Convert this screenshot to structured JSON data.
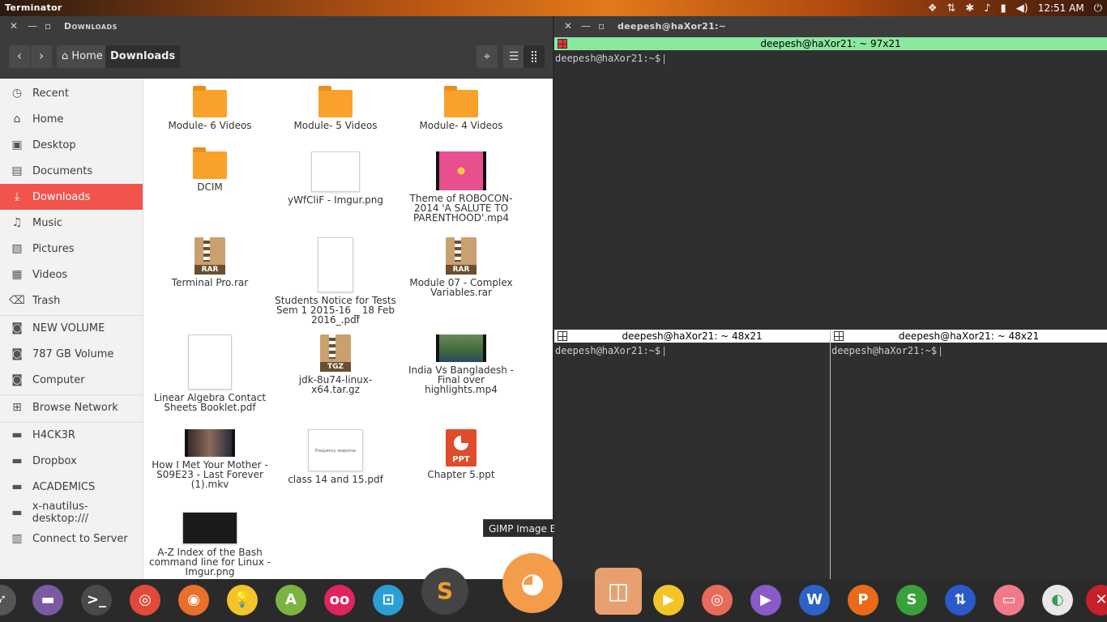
{
  "top_panel": {
    "app_title": "Terminator",
    "clock": "12:51 AM",
    "indicators": [
      "dropbox-icon",
      "network-arrows-icon",
      "bluetooth-icon",
      "notifications-bell-icon",
      "battery-icon",
      "volume-icon",
      "power-icon"
    ]
  },
  "files": {
    "window_title": "Downloads",
    "crumb_home": "Home",
    "crumb_current": "Downloads",
    "sidebar": [
      {
        "label": "Recent",
        "icon": "clock-icon"
      },
      {
        "label": "Home",
        "icon": "home-icon"
      },
      {
        "label": "Desktop",
        "icon": "desktop-icon"
      },
      {
        "label": "Documents",
        "icon": "document-icon"
      },
      {
        "label": "Downloads",
        "icon": "download-icon"
      },
      {
        "label": "Music",
        "icon": "music-icon"
      },
      {
        "label": "Pictures",
        "icon": "picture-icon"
      },
      {
        "label": "Videos",
        "icon": "video-icon"
      },
      {
        "label": "Trash",
        "icon": "trash-icon"
      },
      {
        "label": "NEW VOLUME",
        "icon": "drive-icon"
      },
      {
        "label": "787 GB Volume",
        "icon": "drive-icon"
      },
      {
        "label": "Computer",
        "icon": "computer-icon"
      },
      {
        "label": "Browse Network",
        "icon": "network-icon"
      },
      {
        "label": "H4CK3R",
        "icon": "folder-icon"
      },
      {
        "label": "Dropbox",
        "icon": "folder-icon"
      },
      {
        "label": "ACADEMICS",
        "icon": "folder-icon"
      },
      {
        "label": "x-nautilus-desktop:///",
        "icon": "folder-icon"
      },
      {
        "label": "Connect to Server",
        "icon": "server-icon"
      }
    ],
    "items": [
      {
        "name": "Module- 6 Videos",
        "kind": "folder"
      },
      {
        "name": "Module- 5 Videos",
        "kind": "folder"
      },
      {
        "name": "Module- 4 Videos",
        "kind": "folder"
      },
      {
        "name": "DCIM",
        "kind": "folder"
      },
      {
        "name": "yWfCliF - Imgur.png",
        "kind": "image"
      },
      {
        "name": "Theme of ROBOCON-2014 'A SALUTE TO PARENTHOOD'.mp4",
        "kind": "video"
      },
      {
        "name": "Terminal Pro.rar",
        "kind": "archive",
        "tag": "RAR"
      },
      {
        "name": "Students Notice for Tests Sem 1 2015-16 _ 18 Feb 2016_.pdf",
        "kind": "pdf"
      },
      {
        "name": "Module 07 - Complex Variables.rar",
        "kind": "archive",
        "tag": "RAR"
      },
      {
        "name": "Linear Algebra Contact Sheets Booklet.pdf",
        "kind": "pdf"
      },
      {
        "name": "jdk-8u74-linux-x64.tar.gz",
        "kind": "archive",
        "tag": "TGZ"
      },
      {
        "name": "India Vs Bangladesh - Final over highlights.mp4",
        "kind": "video"
      },
      {
        "name": "How I Met Your Mother - S09E23 - Last Forever (1).mkv",
        "kind": "video"
      },
      {
        "name": "class 14 and 15.pdf",
        "kind": "pdf",
        "thumb_text": "Frequency response"
      },
      {
        "name": "Chapter 5.ppt",
        "kind": "ppt",
        "tag": "PPT"
      },
      {
        "name": "A-Z Index of the Bash command line for Linux - Imgur.png",
        "kind": "image"
      }
    ]
  },
  "tooltip": "GIMP Image Editor",
  "terminator": {
    "window_title": "deepesh@haXor21:~",
    "pane_top_title": "deepesh@haXor21: ~ 97x21",
    "pane_bl_title": "deepesh@haXor21: ~ 48x21",
    "pane_br_title": "deepesh@haXor21: ~ 48x21",
    "prompt": "deepesh@haXor21:~$",
    "active_title_color": "#8ae99f"
  },
  "dock": [
    "rocket-launcher-icon",
    "files-icon",
    "terminal-icon",
    "chrome-icon",
    "firefox-icon",
    "lightbulb-icon",
    "android-studio-icon",
    "flickr-icon",
    "scan-icon",
    "sublime-text-icon",
    "gimp-icon",
    "speaker-icon",
    "media-player-icon",
    "camera-icon",
    "video-player-icon",
    "word-icon",
    "presentation-icon",
    "spreadsheet-icon",
    "transfer-icon",
    "toggle-icon",
    "settings-icon",
    "close-icon"
  ]
}
